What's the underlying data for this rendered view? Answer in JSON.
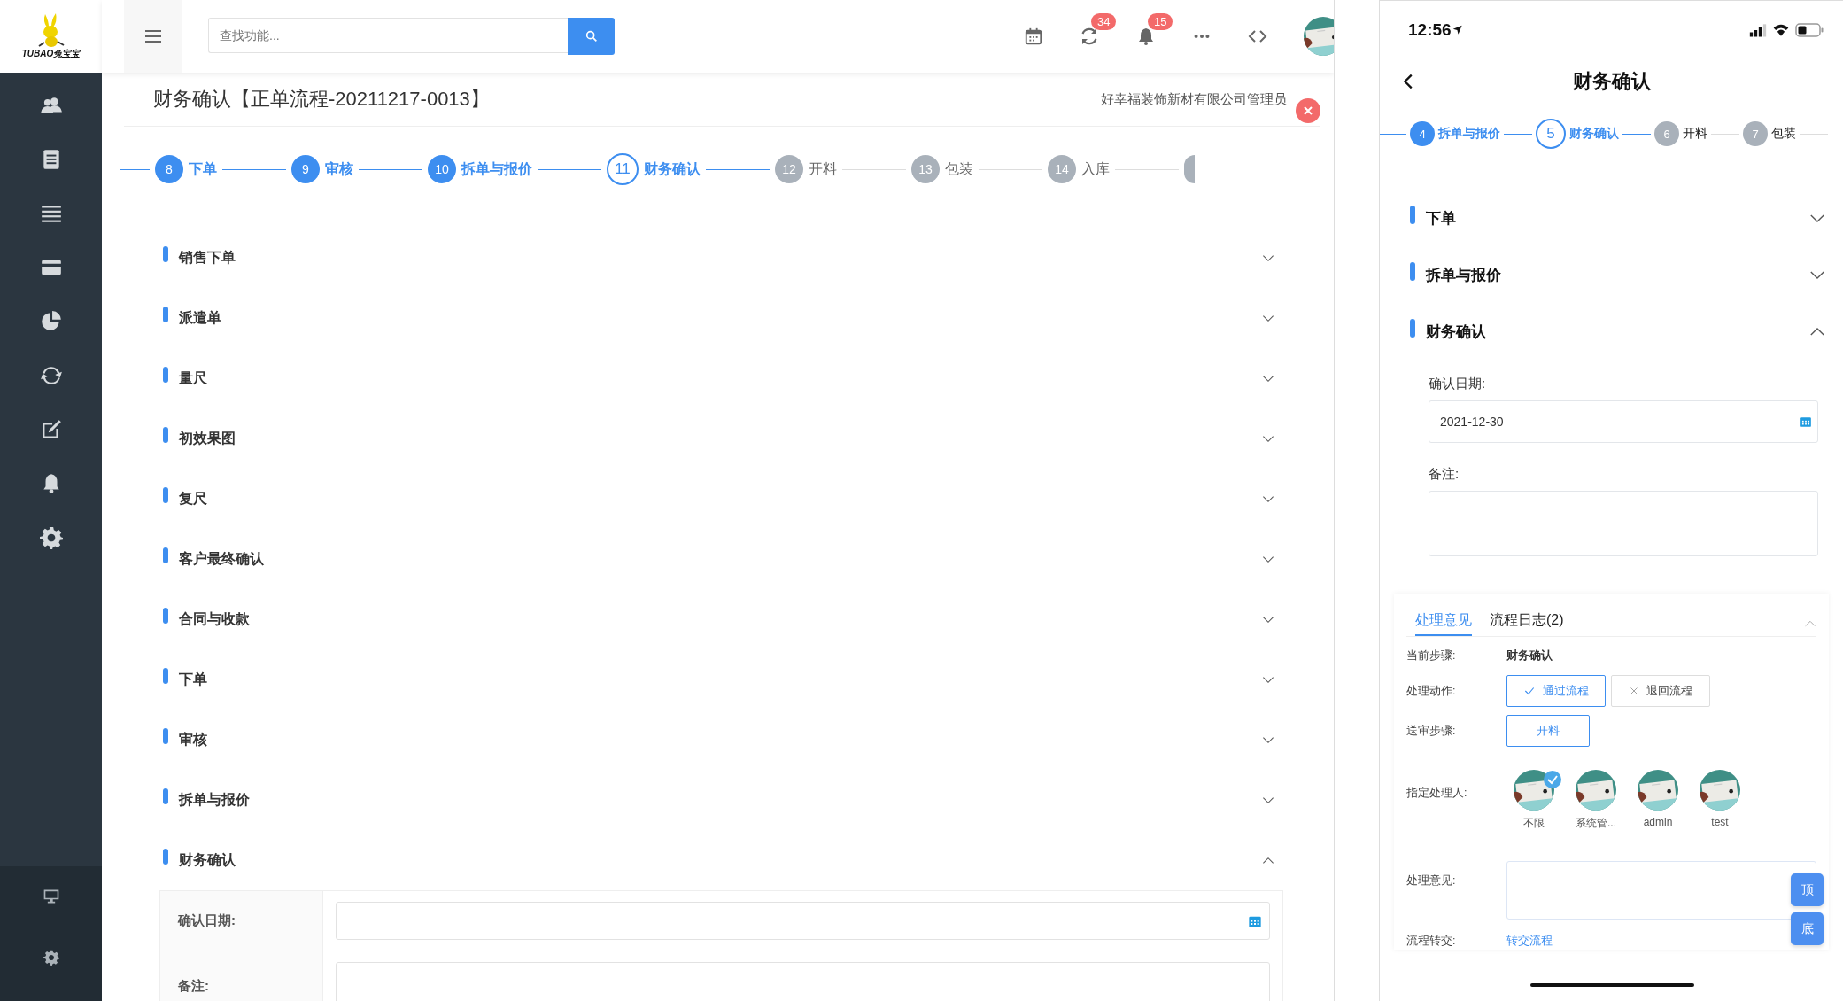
{
  "header": {
    "logo": "TUBAO兔宝宝",
    "search": {
      "placeholder": "查找功能..."
    },
    "badges": [
      {
        "count": "34"
      },
      {
        "count": "15"
      }
    ]
  },
  "desktop": {
    "title": "财务确认【正单流程-20211217-0013】",
    "user": "好幸福装饰新材有限公司管理员",
    "steps": [
      {
        "number": "8",
        "label": "下单",
        "done": true,
        "current": false
      },
      {
        "number": "9",
        "label": "审核",
        "done": true,
        "current": false
      },
      {
        "number": "10",
        "label": "拆单与报价",
        "done": true,
        "current": false
      },
      {
        "number": "11",
        "label": "财务确认",
        "done": false,
        "current": true
      },
      {
        "number": "12",
        "label": "开料",
        "done": false,
        "current": false
      },
      {
        "number": "13",
        "label": "包装",
        "done": false,
        "current": false
      },
      {
        "number": "14",
        "label": "入库",
        "done": false,
        "current": false
      }
    ],
    "sections": [
      {
        "label": "销售下单",
        "expanded": false
      },
      {
        "label": "派遣单",
        "expanded": false
      },
      {
        "label": "量尺",
        "expanded": false
      },
      {
        "label": "初效果图",
        "expanded": false
      },
      {
        "label": "复尺",
        "expanded": false
      },
      {
        "label": "客户最终确认",
        "expanded": false
      },
      {
        "label": "合同与收款",
        "expanded": false
      },
      {
        "label": "下单",
        "expanded": false
      },
      {
        "label": "审核",
        "expanded": false
      },
      {
        "label": "拆单与报价",
        "expanded": false
      },
      {
        "label": "财务确认",
        "expanded": true
      }
    ],
    "form": [
      {
        "label": "确认日期:",
        "kind": "date"
      },
      {
        "label": "备注:",
        "kind": "textarea"
      }
    ]
  },
  "mobile": {
    "time": "12:56",
    "title": "财务确认",
    "steps": [
      {
        "number": "4",
        "label": "拆单与报价",
        "done": true,
        "current": false
      },
      {
        "number": "5",
        "label": "财务确认",
        "done": false,
        "current": true
      },
      {
        "number": "6",
        "label": "开料",
        "done": false,
        "current": false
      },
      {
        "number": "7",
        "label": "包装",
        "done": false,
        "current": false
      }
    ],
    "sections": [
      {
        "label": "下单",
        "expanded": false
      },
      {
        "label": "拆单与报价",
        "expanded": false
      },
      {
        "label": "财务确认",
        "expanded": true
      }
    ],
    "form": [
      {
        "label": "确认日期:",
        "kind": "date",
        "value": "2021-12-30"
      },
      {
        "label": "备注:",
        "kind": "textarea"
      }
    ],
    "tabs": [
      {
        "label": "处理意见",
        "selected": true
      },
      {
        "label": "流程日志(2)",
        "selected": false
      }
    ],
    "current_step": {
      "label": "当前步骤:",
      "value": "财务确认"
    },
    "actions": {
      "label": "处理动作:",
      "buttons": [
        {
          "label": "通过流程",
          "selected": true
        },
        {
          "label": "退回流程",
          "selected": false
        }
      ]
    },
    "send_step": {
      "label": "送审步骤:",
      "button": "开料"
    },
    "handlers": {
      "label": "指定处理人:",
      "people": [
        {
          "name": "不限",
          "selected": true
        },
        {
          "name": "系统管...",
          "selected": false
        },
        {
          "name": "admin",
          "selected": false
        },
        {
          "name": "test",
          "selected": false
        }
      ]
    },
    "opinion": {
      "label": "处理意见:"
    },
    "transfer": {
      "label": "流程转交:",
      "link": "转交流程"
    },
    "float_buttons": [
      "顶",
      "底"
    ]
  }
}
